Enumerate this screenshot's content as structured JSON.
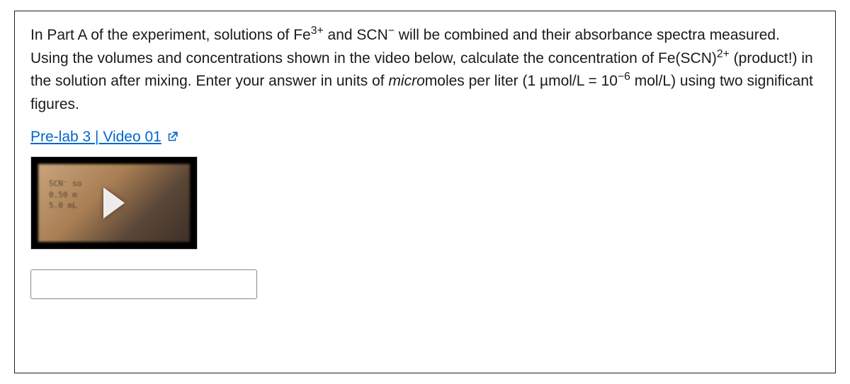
{
  "question": {
    "part1": "In Part A of the experiment, solutions of Fe",
    "sup1": "3+",
    "part2": " and SCN",
    "sup2": "−",
    "part3": " will be combined and their absorbance spectra measured. Using the volumes and concentrations shown in the video below, calculate the concentration of Fe(SCN)",
    "sup3": "2+",
    "part4": " (product!) in the solution after mixing. Enter your answer in units of ",
    "italic_part": "micro",
    "part5": "moles per liter (1 µmol/L = 10",
    "sup4": "−6",
    "part6": " mol/L) using two significant figures."
  },
  "link": {
    "text": "Pre-lab 3 | Video 01"
  },
  "thumbnail": {
    "line1": "SCN⁻ so",
    "line2": "0.50 m",
    "line3": "5.0 mL"
  },
  "input": {
    "value": "",
    "placeholder": ""
  }
}
